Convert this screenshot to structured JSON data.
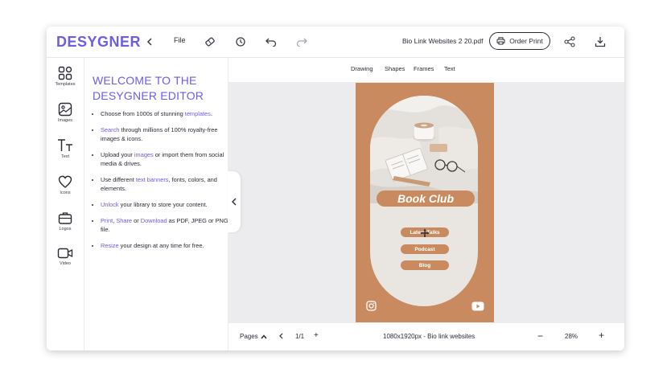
{
  "app": {
    "logo": "DESYGNER"
  },
  "topbar": {
    "file_label": "File",
    "doc_name": "Bio Link Websites 2 20.pdf",
    "order_print_label": "Order Print"
  },
  "rail": {
    "items": [
      {
        "label": "Templates",
        "icon": "templates-icon"
      },
      {
        "label": "Images",
        "icon": "image-icon"
      },
      {
        "label": "Text",
        "icon": "text-icon"
      },
      {
        "label": "Icons",
        "icon": "heart-icon"
      },
      {
        "label": "Logos",
        "icon": "briefcase-icon"
      },
      {
        "label": "Video",
        "icon": "video-icon"
      }
    ]
  },
  "panel": {
    "title": "WELCOME TO THE DESYGNER EDITOR",
    "bullets": [
      {
        "pre": "Choose from 1000s of stunning ",
        "link": "templates",
        "post": "."
      },
      {
        "pre": "",
        "link": "Search",
        "post": " through millions of 100% royalty-free images & icons."
      },
      {
        "pre": "Upload your ",
        "link": "images",
        "post": " or import them from social media & drives."
      },
      {
        "pre": "Use different ",
        "link": "text banners",
        "post": ", fonts, colors, and elements."
      },
      {
        "pre": "",
        "link": "Unlock",
        "post": " your library to store your content."
      },
      {
        "pre": "",
        "link": "Print",
        "mid1": ", ",
        "link2": "Share",
        "mid2": " or ",
        "link3": "Download",
        "post": " as PDF, JPEG or PNG file."
      },
      {
        "pre": "",
        "link": "Resize",
        "post": " your design at any time for free."
      }
    ]
  },
  "toolbar2": {
    "tabs": [
      "Drawing",
      "Shapes",
      "Frames",
      "Text"
    ]
  },
  "design": {
    "title": "Book Club",
    "links": [
      "Latest Talks",
      "Podcast",
      "Blog"
    ],
    "colors": {
      "background": "#c88a5e",
      "arch": "#e9e6e2"
    }
  },
  "bottombar": {
    "pages_label": "Pages",
    "page_indicator": "1/1",
    "size_info": "1080x1920px - Bio link websites",
    "zoom": "28%"
  },
  "colors": {
    "accent": "#6c5ce7"
  }
}
